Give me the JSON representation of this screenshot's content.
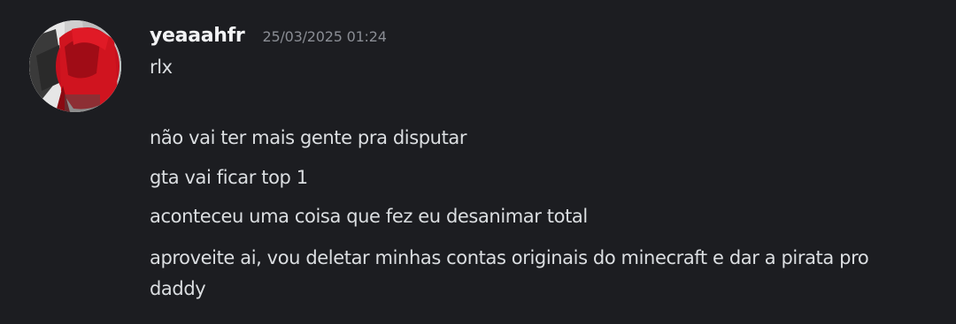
{
  "message": {
    "author": {
      "username": "yeaaahfr",
      "avatar_icon": "user-avatar"
    },
    "timestamp": "25/03/2025 01:24",
    "lines": [
      "rlx",
      "não vai ter mais gente pra disputar",
      "gta vai ficar top 1",
      "aconteceu uma coisa que fez eu desanimar total",
      "aproveite ai, vou deletar minhas contas originais do minecraft e dar a pirata pro",
      "daddy"
    ]
  },
  "colors": {
    "background": "#1c1d21",
    "username": "#f2f3f5",
    "timestamp": "#8a8d94",
    "message_text": "#dbdee1"
  }
}
